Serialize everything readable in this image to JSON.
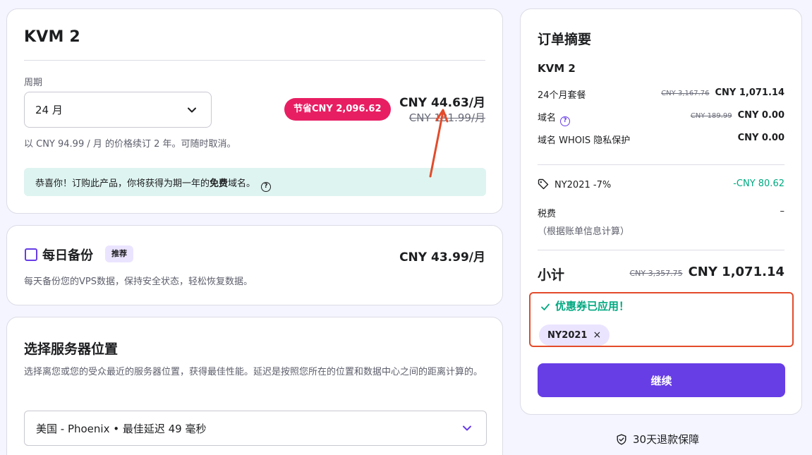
{
  "plan": {
    "title": "KVM 2",
    "period_label": "周期",
    "period_value": "24 月",
    "save_badge": "节省CNY 2,096.62",
    "price": "CNY 44.63/月",
    "old_price": "CNY 131.99/月",
    "renew_note": "以 CNY 94.99 / 月 的价格续订 2 年。可随时取消。",
    "congrats_pre": "恭喜你！订购此产品，你将获得为期一年的",
    "congrats_bold": "免费",
    "congrats_post": "域名。",
    "help_glyph": "?"
  },
  "backup": {
    "title": "每日备份",
    "badge": "推荐",
    "price": "CNY 43.99/月",
    "description": "每天备份您的VPS数据，保持安全状态，轻松恢复数据。"
  },
  "location": {
    "title": "选择服务器位置",
    "description": "选择离您或您的受众最近的服务器位置，获得最佳性能。延迟是按照您所在的位置和数据中心之间的距离计算的。",
    "selected": "美国 - Phoenix • 最佳延迟 49 毫秒"
  },
  "summary": {
    "title": "订单摘要",
    "product": "KVM 2",
    "rows": [
      {
        "label": "24个月套餐",
        "old": "CNY 3,167.76",
        "value": "CNY 1,071.14"
      },
      {
        "label": "域名",
        "old": "CNY 189.99",
        "value": "CNY 0.00"
      },
      {
        "label": "域名 WHOIS 隐私保护",
        "old": "",
        "value": "CNY 0.00"
      }
    ],
    "discount_label": "NY2021 -7%",
    "discount_value": "-CNY 80.62",
    "tax_label": "税费",
    "tax_value": "–",
    "tax_note": "（根据账单信息计算）",
    "subtotal_label": "小计",
    "subtotal_old": "CNY 3,357.75",
    "subtotal_value": "CNY 1,071.14",
    "coupon_message": "优惠券已应用！",
    "coupon_code": "NY2021",
    "coupon_remove": "×",
    "continue_label": "继续",
    "guarantee": "30天退款保障"
  },
  "colors": {
    "accent": "#673de6",
    "badge_pink": "#e81e63",
    "success_green": "#00a880",
    "annotation_red": "#e34b2a"
  },
  "icons": [
    "chevron-down-icon",
    "help-circle-icon",
    "tag-icon",
    "check-icon",
    "close-icon",
    "shield-check-icon"
  ]
}
